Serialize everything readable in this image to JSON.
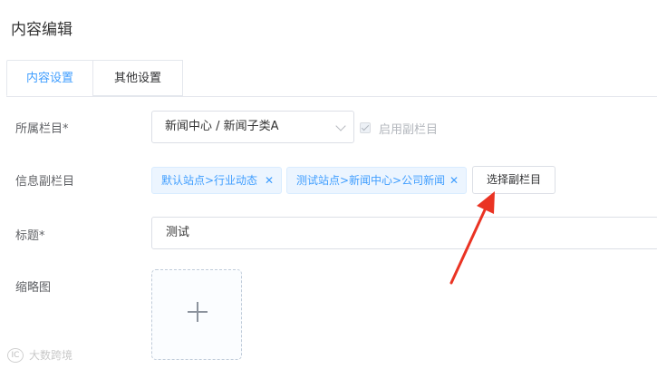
{
  "page_title": "内容编辑",
  "tabs": [
    {
      "label": "内容设置",
      "active": true
    },
    {
      "label": "其他设置",
      "active": false
    }
  ],
  "form": {
    "category_label": "所属栏目*",
    "category_value": "新闻中心 / 新闻子类A",
    "enable_sub_label": "启用副栏目",
    "sub_category_label": "信息副栏目",
    "sub_tags": [
      "默认站点>行业动态",
      "测试站点>新闻中心>公司新闻"
    ],
    "tag_close": "✕",
    "select_sub_button": "选择副栏目",
    "title_label": "标题*",
    "title_value": "测试",
    "thumbnail_label": "缩略图"
  },
  "watermark": {
    "logo": "IC",
    "text": "大数跨境"
  },
  "colors": {
    "accent": "#409eff",
    "tag_bg": "#ecf5ff",
    "arrow": "#ea3323"
  }
}
